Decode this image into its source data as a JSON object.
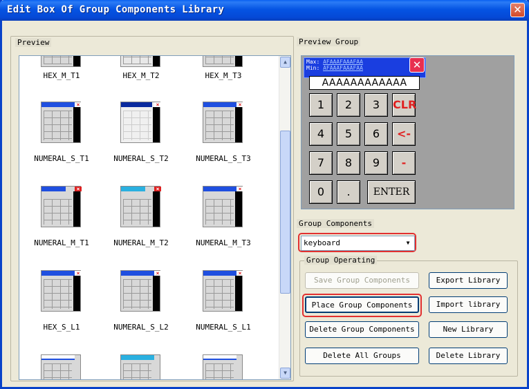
{
  "window": {
    "title": "Edit Box Of Group Components Library",
    "close_glyph": "✕"
  },
  "preview": {
    "label": "Preview",
    "items": [
      {
        "name": "HEX_M_T1"
      },
      {
        "name": "HEX_M_T2"
      },
      {
        "name": "HEX_M_T3"
      },
      {
        "name": "NUMERAL_S_T1"
      },
      {
        "name": "NUMERAL_S_T2"
      },
      {
        "name": "NUMERAL_S_T3"
      },
      {
        "name": "NUMERAL_M_T1"
      },
      {
        "name": "NUMERAL_M_T2"
      },
      {
        "name": "NUMERAL_M_T3"
      },
      {
        "name": "HEX_S_L1"
      },
      {
        "name": "NUMERAL_S_L2"
      },
      {
        "name": "NUMERAL_S_L1"
      }
    ],
    "scroll_up": "▲",
    "scroll_down": "▼"
  },
  "preview_group": {
    "label": "Preview Group",
    "max_label": "Max:",
    "max_value": "AFAAAFAAAFAA",
    "min_label": "Min:",
    "min_value": "AFAAAFAAAFAA",
    "close_glyph": "✕",
    "display": "AAAAAAAAAAAA",
    "keys": {
      "k1": "1",
      "k2": "2",
      "k3": "3",
      "clr": "CLR",
      "k4": "4",
      "k5": "5",
      "k6": "6",
      "back": "<-",
      "k7": "7",
      "k8": "8",
      "k9": "9",
      "minus": "-",
      "k0": "0",
      "dot": ".",
      "enter": "ENTER"
    }
  },
  "group_components": {
    "label": "Group Components",
    "selected": "keyboard",
    "arrow": "▼"
  },
  "group_operating": {
    "label": "Group Operating",
    "save": "Save Group Components",
    "export": "Export Library",
    "place": "Place Group Components",
    "import": "Import library",
    "delete_group": "Delete Group Components",
    "new_library": "New Library",
    "delete_all": "Delete All Groups",
    "delete_library": "Delete Library"
  }
}
